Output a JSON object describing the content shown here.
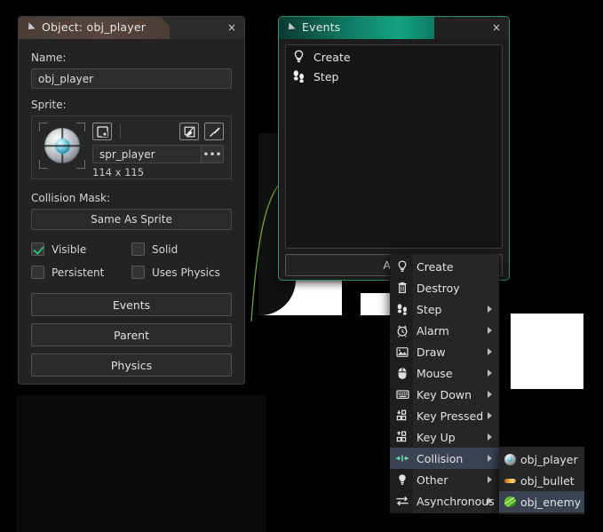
{
  "object_window": {
    "title": "Object: obj_player",
    "close_label": "×",
    "name_label": "Name:",
    "name_value": "obj_player",
    "sprite_label": "Sprite:",
    "sprite_name": "spr_player",
    "sprite_dimensions": "114 x 115",
    "sprite_ellipsis": "•••",
    "tools": [
      {
        "name": "new-sprite-icon"
      },
      {
        "name": "edit-sprite-icon"
      },
      {
        "name": "paint-sprite-icon"
      }
    ],
    "collision_mask_label": "Collision Mask:",
    "collision_mask_value": "Same As Sprite",
    "checkboxes": [
      {
        "label": "Visible",
        "checked": true
      },
      {
        "label": "Solid",
        "checked": false
      },
      {
        "label": "Persistent",
        "checked": false
      },
      {
        "label": "Uses Physics",
        "checked": false
      }
    ],
    "buttons": [
      {
        "label": "Events"
      },
      {
        "label": "Parent"
      },
      {
        "label": "Physics"
      }
    ]
  },
  "events_window": {
    "title": "Events",
    "close_label": "×",
    "events": [
      {
        "label": "Create",
        "icon": "lightbulb-icon"
      },
      {
        "label": "Step",
        "icon": "footprints-icon"
      }
    ],
    "add_label": "Add"
  },
  "context_menu": {
    "items": [
      {
        "label": "Create",
        "icon": "lightbulb-icon",
        "submenu": false,
        "selected": false
      },
      {
        "label": "Destroy",
        "icon": "trash-icon",
        "submenu": false,
        "selected": false
      },
      {
        "label": "Step",
        "icon": "footprints-icon",
        "submenu": true,
        "selected": false
      },
      {
        "label": "Alarm",
        "icon": "alarm-clock-icon",
        "submenu": true,
        "selected": false
      },
      {
        "label": "Draw",
        "icon": "image-icon",
        "submenu": true,
        "selected": false
      },
      {
        "label": "Mouse",
        "icon": "mouse-icon",
        "submenu": true,
        "selected": false
      },
      {
        "label": "Key Down",
        "icon": "keyboard-icon",
        "submenu": true,
        "selected": false
      },
      {
        "label": "Key Pressed",
        "icon": "key-down-icon",
        "submenu": true,
        "selected": false
      },
      {
        "label": "Key Up",
        "icon": "key-up-icon",
        "submenu": true,
        "selected": false
      },
      {
        "label": "Collision",
        "icon": "collision-icon",
        "submenu": true,
        "selected": true
      },
      {
        "label": "Other",
        "icon": "lightbulb-icon",
        "submenu": true,
        "selected": false
      },
      {
        "label": "Asynchronous",
        "icon": "async-icon",
        "submenu": true,
        "selected": false
      }
    ]
  },
  "collision_submenu": {
    "items": [
      {
        "label": "obj_player",
        "icon": "player-sprite-icon",
        "selected": false
      },
      {
        "label": "obj_bullet",
        "icon": "bullet-sprite-icon",
        "selected": false
      },
      {
        "label": "obj_enemy",
        "icon": "enemy-sprite-icon",
        "selected": true
      }
    ]
  },
  "theme": {
    "accent_teal": "#13a483",
    "accent_brown": "#55453c",
    "check_green": "#2eb872",
    "menu_highlight": "#3b4352"
  }
}
